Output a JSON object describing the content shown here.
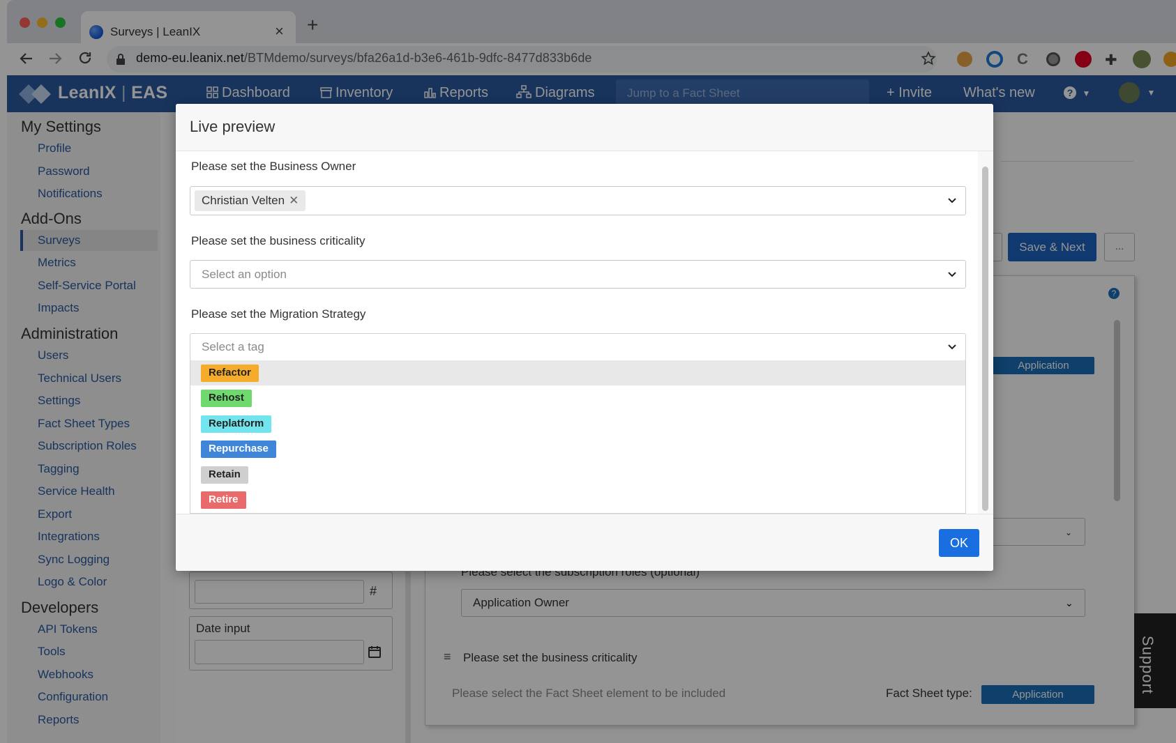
{
  "browser": {
    "tab_title": "Surveys | LeanIX",
    "url_host": "demo-eu.leanix.net",
    "url_path": "/BTMdemo/surveys/bfa26a1d-b3e6-461b-9dfc-8477d833b6de",
    "icons": [
      "back-icon",
      "forward-icon",
      "reload-icon",
      "lock-icon",
      "star-icon",
      "extension-icons"
    ]
  },
  "appnav": {
    "brand": "LeanIX",
    "brand_suffix": "EAS",
    "dashboard": "Dashboard",
    "inventory": "Inventory",
    "reports": "Reports",
    "diagrams": "Diagrams",
    "jump_placeholder": "Jump to a Fact Sheet",
    "invite": "+ Invite",
    "whats_new": "What's new"
  },
  "sidebar": {
    "my_settings": "My Settings",
    "my_settings_items": [
      "Profile",
      "Password",
      "Notifications"
    ],
    "addons": "Add-Ons",
    "addons_items": [
      "Surveys",
      "Metrics",
      "Self-Service Portal",
      "Impacts"
    ],
    "administration": "Administration",
    "administration_items": [
      "Users",
      "Technical Users",
      "Settings",
      "Fact Sheet Types",
      "Subscription Roles",
      "Tagging",
      "Service Health",
      "Export",
      "Integrations",
      "Sync Logging",
      "Logo & Color"
    ],
    "developers": "Developers",
    "developers_items": [
      "API Tokens",
      "Tools",
      "Webhooks",
      "Configuration",
      "Reports"
    ]
  },
  "background": {
    "save_next": "Save & Next",
    "more": "...",
    "app_tag_top": "Application",
    "date_input": "Date input",
    "hash": "#",
    "subscription_label": "Please select the subscription roles (optional)",
    "subscription_value": "Application Owner",
    "criticality_label": "Please set the business criticality",
    "element_hint": "Please select the Fact Sheet element to be included",
    "fs_type_label": "Fact Sheet type:",
    "app_tag_bottom": "Application"
  },
  "modal": {
    "title": "Live preview",
    "q1_label": "Please set the Business Owner",
    "q1_chip": "Christian Velten",
    "q2_label": "Please set the business criticality",
    "q2_placeholder": "Select an option",
    "q3_label": "Please set the Migration Strategy",
    "q3_placeholder": "Select a tag",
    "options": [
      {
        "label": "Refactor",
        "color": "#f6ac2b"
      },
      {
        "label": "Rehost",
        "color": "#6fd86f"
      },
      {
        "label": "Replatform",
        "color": "#72e4ee"
      },
      {
        "label": "Repurchase",
        "color": "#3f86d8"
      },
      {
        "label": "Retain",
        "color": "#cfcfcf"
      },
      {
        "label": "Retire",
        "color": "#e86a6a"
      }
    ],
    "ok": "OK"
  },
  "support": "Support"
}
